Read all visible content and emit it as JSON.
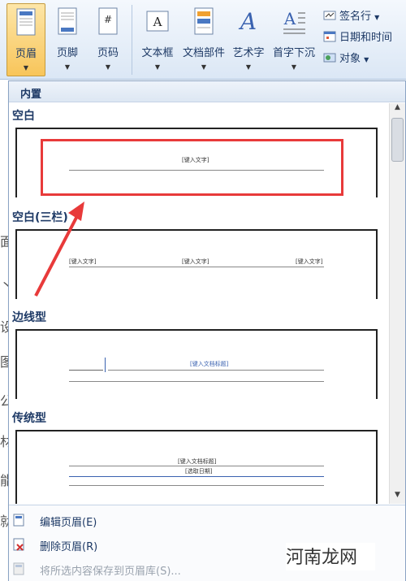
{
  "ribbon": {
    "buttons": [
      {
        "label": "页眉",
        "active": true
      },
      {
        "label": "页脚",
        "active": false
      },
      {
        "label": "页码",
        "active": false
      },
      {
        "label": "文本框",
        "active": false
      },
      {
        "label": "文档部件",
        "active": false
      },
      {
        "label": "艺术字",
        "active": false
      },
      {
        "label": "首字下沉",
        "active": false
      }
    ],
    "small": [
      {
        "label": "签名行"
      },
      {
        "label": "日期和时间"
      },
      {
        "label": "对象"
      }
    ]
  },
  "panel": {
    "section": "内置",
    "categories": [
      {
        "name": "空白"
      },
      {
        "name": "空白(三栏)"
      },
      {
        "name": "边线型"
      },
      {
        "name": "传统型"
      }
    ],
    "placeholders": {
      "blank": "[键入文字]",
      "three_col": [
        "[键入文字]",
        "[键入文字]",
        "[键入文字]"
      ],
      "sideline": "[键入文档标题]",
      "traditional_title": "[键入文档标题]",
      "traditional_date": "[选取日期]"
    },
    "menu": [
      {
        "label": "编辑页眉(E)",
        "enabled": true
      },
      {
        "label": "删除页眉(R)",
        "enabled": true
      },
      {
        "label": "将所选内容保存到页眉库(S)...",
        "enabled": false
      }
    ]
  },
  "doc_strip": [
    "面",
    "丶",
    "设",
    "图",
    "公",
    "材",
    "能",
    "就"
  ],
  "watermark": "河南龙网",
  "colors": {
    "accent": "#1e3a66",
    "highlight": "#e83a3a",
    "active_button": "#f8c55a"
  }
}
